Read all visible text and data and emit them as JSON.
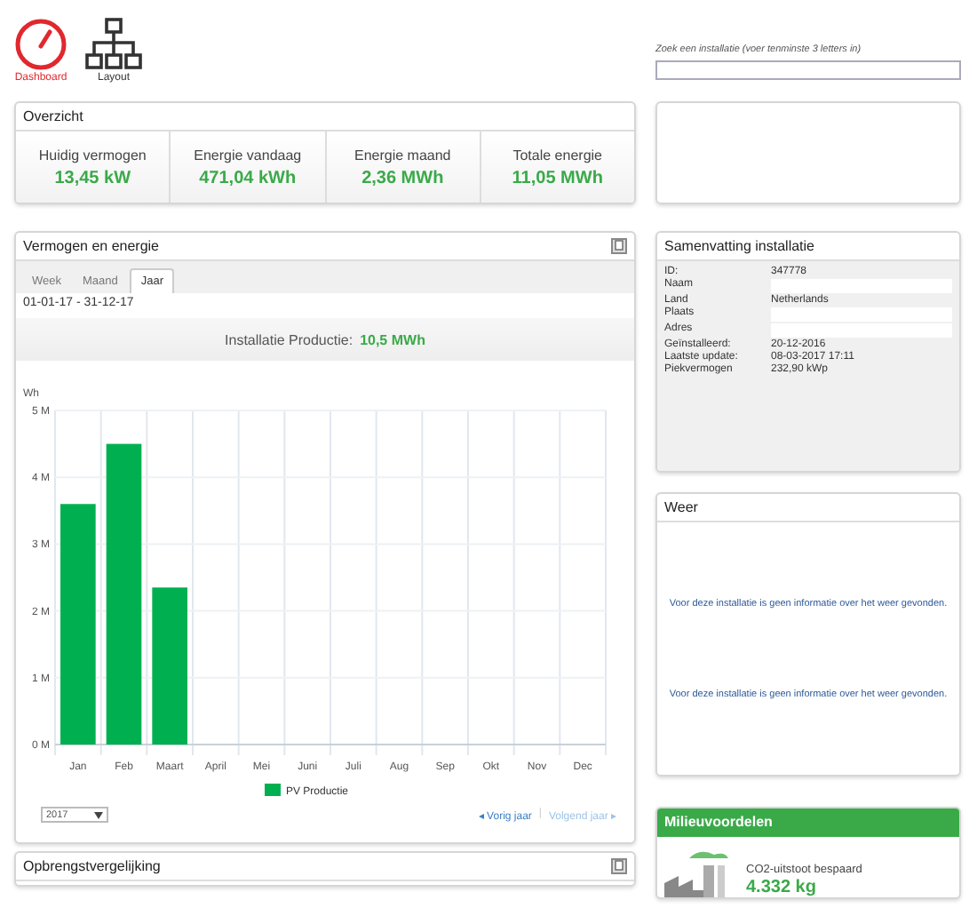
{
  "nav": [
    {
      "kind": "gauge",
      "label": "Dashboard",
      "selected": true
    },
    {
      "kind": "tree",
      "label": "Layout",
      "selected": false
    }
  ],
  "search": {
    "label": "Zoek een installatie (voer tenminste 3 letters in)"
  },
  "overview": {
    "title": "Overzicht",
    "stats": [
      {
        "label": "Huidig vermogen",
        "value": "13,45 kW"
      },
      {
        "label": "Energie vandaag",
        "value": "471,04 kWh"
      },
      {
        "label": "Energie maand",
        "value": "2,36 MWh"
      },
      {
        "label": "Totale energie",
        "value": "11,05 MWh"
      }
    ]
  },
  "energy": {
    "title": "Vermogen en energie",
    "tabs": [
      {
        "label": "Week",
        "selected": false
      },
      {
        "label": "Maand",
        "selected": false
      },
      {
        "label": "Jaar",
        "selected": true
      }
    ],
    "period": "01-01-17 - 31-12-17",
    "production_label": "Installatie Productie:",
    "production_value": "10,5 MWh",
    "chart_data": {
      "type": "bar",
      "ylabel": "Wh",
      "categories": [
        "Jan",
        "Feb",
        "Maart",
        "April",
        "Mei",
        "Juni",
        "Juli",
        "Aug",
        "Sep",
        "Okt",
        "Nov",
        "Dec"
      ],
      "series": [
        {
          "name": "PV Productie",
          "color": "#00b050",
          "values": [
            3.6,
            4.5,
            2.35,
            null,
            null,
            null,
            null,
            null,
            null,
            null,
            null,
            null
          ]
        }
      ],
      "ylim": [
        0,
        5
      ],
      "grid": true,
      "yticks": [
        {
          "value": 0,
          "label": "0 M"
        },
        {
          "value": 1,
          "label": "1 M"
        },
        {
          "value": 2,
          "label": "2 M"
        },
        {
          "value": 3,
          "label": "3 M"
        },
        {
          "value": 4,
          "label": "4 M"
        },
        {
          "value": 5,
          "label": "5 M"
        }
      ]
    },
    "year": "2017",
    "links": [
      {
        "label": "◂ Vorig jaar",
        "disabled": false
      },
      {
        "label": "Volgend jaar ▸",
        "disabled": true
      }
    ],
    "separator": "|"
  },
  "comparison": {
    "title": "Opbrengstvergelijking"
  },
  "summary": {
    "title": "Samenvatting installatie",
    "rows": [
      {
        "label": "ID:",
        "value": "347778",
        "redacted": false
      },
      {
        "label": "Naam",
        "redacted": true
      },
      {
        "label": "Land",
        "value": "Netherlands",
        "redacted": false
      },
      {
        "label": "Plaats",
        "redacted": true
      },
      {
        "label": "Adres",
        "redacted": true
      },
      {
        "label": "Geïnstalleerd:",
        "value": "20-12-2016",
        "redacted": false
      },
      {
        "label": "Laatste update:",
        "value": "08-03-2017 17:11",
        "redacted": false
      },
      {
        "label": "Piekvermogen",
        "value": "232,90 kWp",
        "redacted": false
      }
    ]
  },
  "weather": {
    "title": "Weer",
    "messages": [
      "Voor deze installatie is geen informatie over het weer gevonden.",
      "Voor deze installatie is geen informatie over het weer gevonden."
    ]
  },
  "environment": {
    "title": "Milieuvoordelen",
    "label": "CO2-uitstoot bespaard",
    "value": "4.332 kg"
  }
}
